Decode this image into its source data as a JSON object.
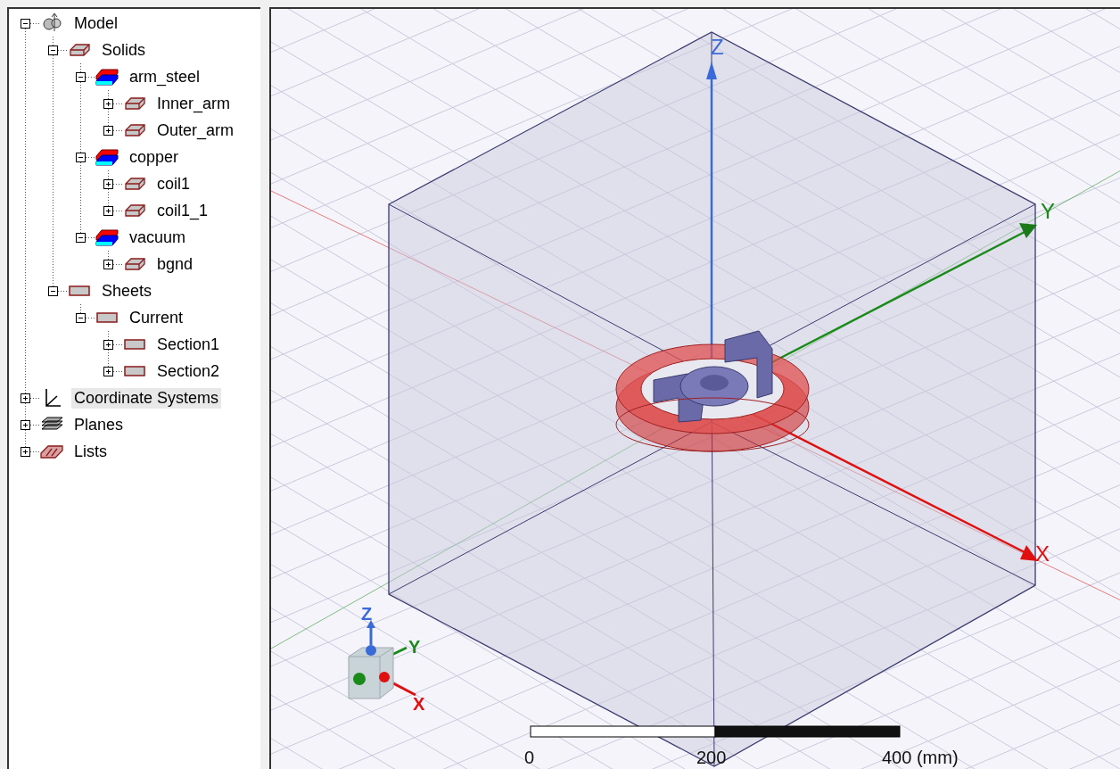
{
  "tree": [
    {
      "label": "Model",
      "kind": "model",
      "expanded": true,
      "selected": false,
      "children": [
        {
          "label": "Solids",
          "kind": "solid",
          "expanded": true,
          "selected": false,
          "children": [
            {
              "label": "arm_steel",
              "kind": "material",
              "expanded": true,
              "selected": false,
              "children": [
                {
                  "label": "Inner_arm",
                  "kind": "solid",
                  "expanded": false,
                  "selected": false
                },
                {
                  "label": "Outer_arm",
                  "kind": "solid",
                  "expanded": false,
                  "selected": false
                }
              ]
            },
            {
              "label": "copper",
              "kind": "material",
              "expanded": true,
              "selected": false,
              "children": [
                {
                  "label": "coil1",
                  "kind": "solid",
                  "expanded": false,
                  "selected": false
                },
                {
                  "label": "coil1_1",
                  "kind": "solid",
                  "expanded": false,
                  "selected": false
                }
              ]
            },
            {
              "label": "vacuum",
              "kind": "material",
              "expanded": true,
              "selected": false,
              "children": [
                {
                  "label": "bgnd",
                  "kind": "solid",
                  "expanded": false,
                  "selected": false
                }
              ]
            }
          ]
        },
        {
          "label": "Sheets",
          "kind": "sheet",
          "expanded": true,
          "selected": false,
          "children": [
            {
              "label": "Current",
              "kind": "sheet",
              "expanded": true,
              "selected": false,
              "children": [
                {
                  "label": "Section1",
                  "kind": "sheet",
                  "expanded": false,
                  "selected": false
                },
                {
                  "label": "Section2",
                  "kind": "sheet",
                  "expanded": false,
                  "selected": false
                }
              ]
            }
          ]
        }
      ]
    },
    {
      "label": "Coordinate Systems",
      "kind": "coords",
      "expanded": false,
      "selected": true
    },
    {
      "label": "Planes",
      "kind": "planes",
      "expanded": false,
      "selected": false
    },
    {
      "label": "Lists",
      "kind": "lists",
      "expanded": false,
      "selected": false
    }
  ],
  "viewport": {
    "axis_labels": [
      "Z",
      "Y",
      "X"
    ],
    "triad_labels": [
      "Z",
      "Y",
      "X"
    ],
    "scale_labels": [
      "0",
      "200",
      "400 (mm)"
    ]
  }
}
